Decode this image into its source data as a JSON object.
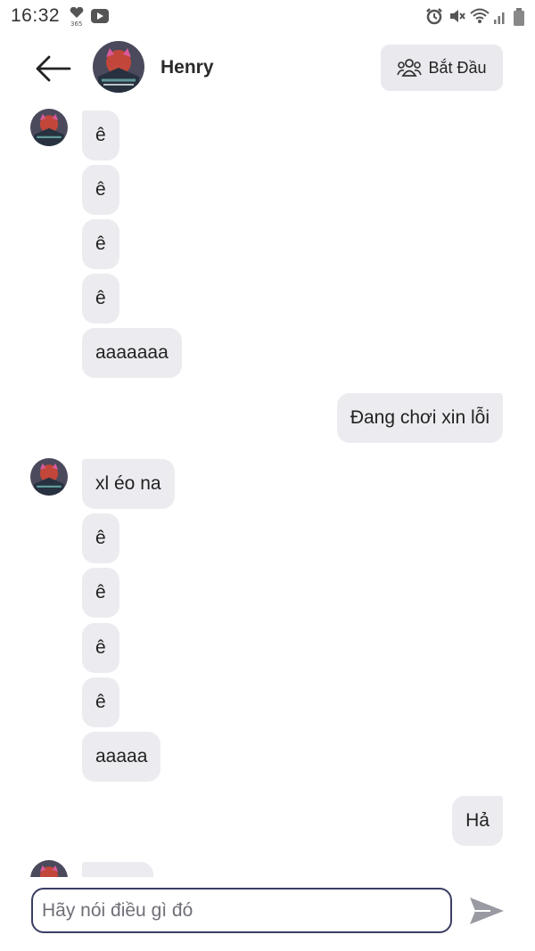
{
  "status_bar": {
    "time": "16:32",
    "icons": [
      "heart-365-icon",
      "media-play-icon",
      "alarm-icon",
      "mute-icon",
      "wifi-icon",
      "signal-icon",
      "battery-icon"
    ]
  },
  "header": {
    "back_icon": "arrow-left-icon",
    "contact_name": "Henry",
    "start_button_label": "Bắt Đầu",
    "start_button_icon": "group-icon"
  },
  "messages": [
    {
      "side": "in",
      "text": "ê",
      "show_avatar": true
    },
    {
      "side": "in",
      "text": "ê"
    },
    {
      "side": "in",
      "text": "ê"
    },
    {
      "side": "in",
      "text": "ê"
    },
    {
      "side": "in",
      "text": "aaaaaaa"
    },
    {
      "side": "out",
      "text": "Đang chơi xin lỗi"
    },
    {
      "side": "in",
      "text": "xl éo na",
      "show_avatar": true
    },
    {
      "side": "in",
      "text": "ê"
    },
    {
      "side": "in",
      "text": "ê"
    },
    {
      "side": "in",
      "text": "ê"
    },
    {
      "side": "in",
      "text": "ê"
    },
    {
      "side": "in",
      "text": "aaaaa"
    },
    {
      "side": "out",
      "text": "Hả"
    },
    {
      "side": "in",
      "text": "",
      "show_avatar": true
    }
  ],
  "composer": {
    "placeholder": "Hãy nói điều gì đó",
    "send_icon": "send-icon"
  },
  "colors": {
    "bubble": "#ececf0",
    "input_border": "#3b3e63",
    "send": "#9a9aa3"
  }
}
